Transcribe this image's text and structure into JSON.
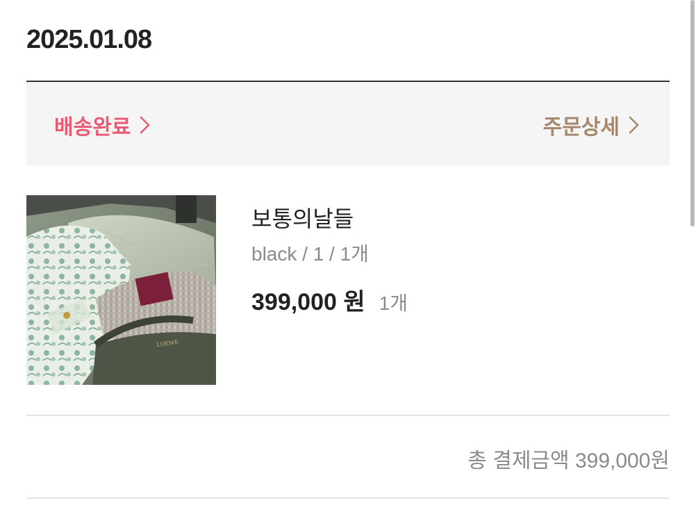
{
  "order": {
    "date": "2025.01.08",
    "status_label": "배송완료",
    "detail_label": "주문상세"
  },
  "product": {
    "name": "보통의날들",
    "option": "black / 1 / 1개",
    "price": "399,000 원",
    "quantity": "1개",
    "image_desc_brand": "LOEWE"
  },
  "summary": {
    "total": "총 결제금액 399,000원"
  },
  "colors": {
    "status_accent": "#ea5a73",
    "detail_accent": "#a6876a"
  }
}
